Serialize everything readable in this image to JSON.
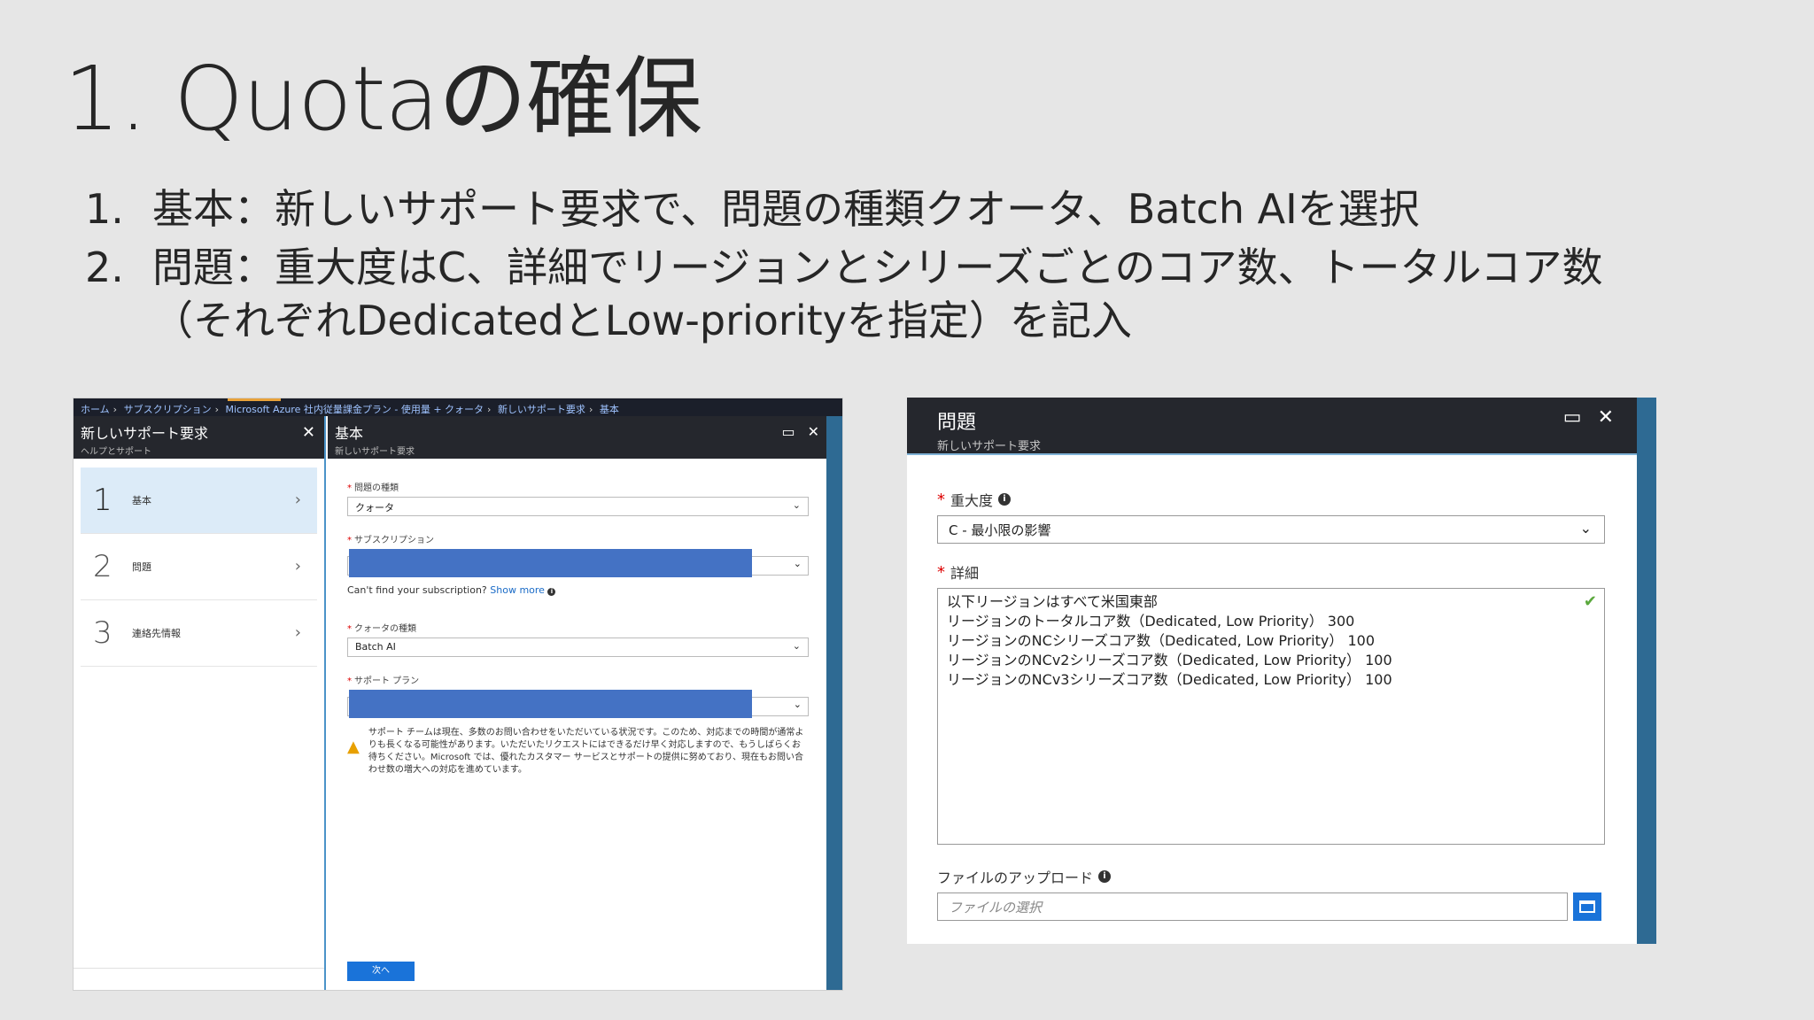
{
  "slide": {
    "title": "1. Quotaの確保",
    "bullets": [
      {
        "num": "1.",
        "text": "基本：新しいサポート要求で、問題の種類クオータ、Batch AIを選択"
      },
      {
        "num": "2.",
        "text": "問題：重大度はC、詳細でリージョンとシリーズごとのコア数、トータルコア数（それぞれDedicatedとLow-priorityを指定）を記入"
      }
    ]
  },
  "left_shot": {
    "breadcrumb": [
      "ホーム",
      "サブスクリプション",
      "Microsoft Azure 社内従量課金プラン - 使用量 + クォータ",
      "新しいサポート要求",
      "基本"
    ],
    "list_blade": {
      "title": "新しいサポート要求",
      "subtitle": "ヘルプとサポート",
      "steps": [
        {
          "num": "1",
          "label": "基本"
        },
        {
          "num": "2",
          "label": "問題"
        },
        {
          "num": "3",
          "label": "連絡先情報"
        }
      ]
    },
    "main_blade": {
      "title": "基本",
      "subtitle": "新しいサポート要求",
      "issue_type_label": "問題の種類",
      "issue_type_value": "クォータ",
      "subscription_label": "サブスクリプション",
      "hint_text": "Can't find your subscription?",
      "hint_link": "Show more",
      "quota_type_label": "クォータの種類",
      "quota_type_value": "Batch AI",
      "support_plan_label": "サポート プラン",
      "warning_text": "サポート チームは現在、多数のお問い合わせをいただいている状況です。このため、対応までの時間が通常よりも長くなる可能性があります。いただいたリクエストにはできるだけ早く対応しますので、もうしばらくお待ちください。Microsoft では、優れたカスタマー サービスとサポートの提供に努めており、現在もお問い合わせ数の増大への対応を進めています。",
      "next_label": "次へ"
    }
  },
  "right_shot": {
    "title": "問題",
    "subtitle": "新しいサポート要求",
    "severity_label": "重大度",
    "severity_value": "C - 最小限の影響",
    "details_label": "詳細",
    "details_lines": [
      "以下リージョンはすべて米国東部",
      "リージョンのトータルコア数（Dedicated, Low Priority） 300",
      "リージョンのNCシリーズコア数（Dedicated, Low Priority） 100",
      "リージョンのNCv2シリーズコア数（Dedicated, Low Priority） 100",
      "リージョンのNCv3シリーズコア数（Dedicated, Low Priority） 100"
    ],
    "upload_label": "ファイルのアップロード",
    "upload_placeholder": "ファイルの選択"
  }
}
